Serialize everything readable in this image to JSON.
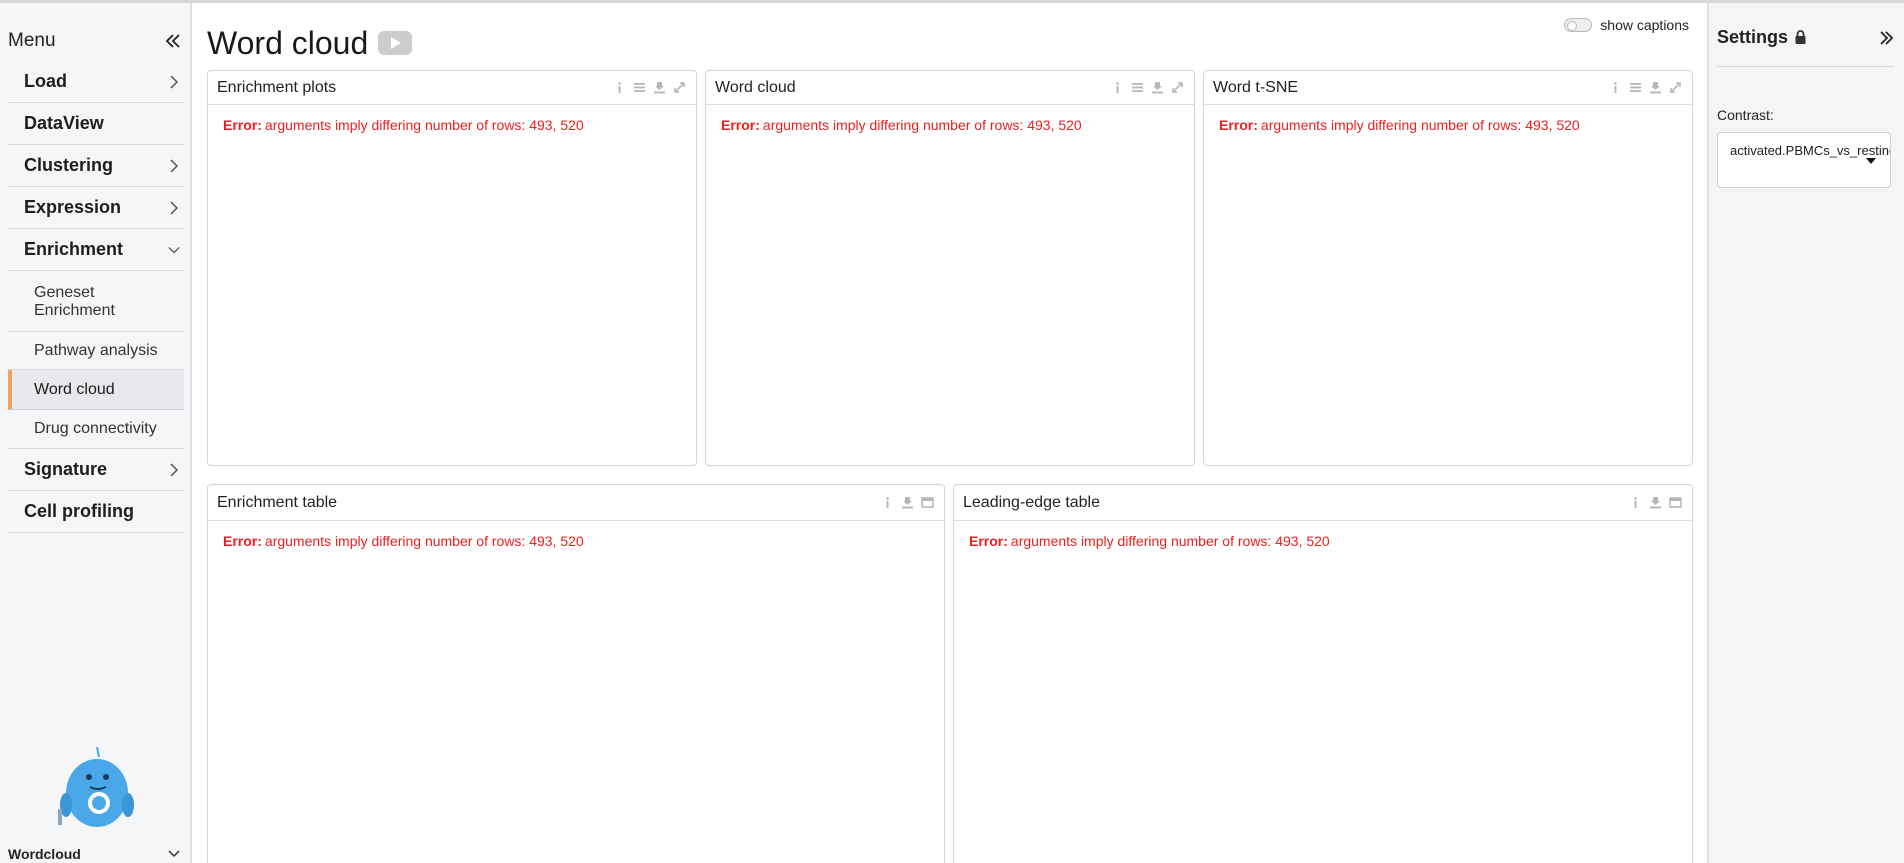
{
  "sidebar": {
    "title": "Menu",
    "items": [
      {
        "label": "Load",
        "chevron": "right"
      },
      {
        "label": "DataView",
        "chevron": ""
      },
      {
        "label": "Clustering",
        "chevron": "right"
      },
      {
        "label": "Expression",
        "chevron": "right"
      },
      {
        "label": "Enrichment",
        "chevron": "down"
      }
    ],
    "subitems": [
      {
        "label": "Geneset\nEnrichment"
      },
      {
        "label": "Pathway analysis"
      },
      {
        "label": "Word cloud",
        "active": true
      },
      {
        "label": "Drug connectivity"
      }
    ],
    "items_after": [
      {
        "label": "Signature",
        "chevron": "right"
      },
      {
        "label": "Cell profiling",
        "chevron": ""
      }
    ],
    "footer_label": "Wordcloud"
  },
  "main": {
    "title": "Word cloud",
    "show_captions_label": "show captions",
    "error_prefix": "Error:",
    "error_message": "arguments imply differing number of rows: 493, 520",
    "panels": [
      {
        "title": "Enrichment plots"
      },
      {
        "title": "Word cloud"
      },
      {
        "title": "Word t-SNE"
      },
      {
        "title": "Enrichment table"
      },
      {
        "title": "Leading-edge table"
      }
    ]
  },
  "settings": {
    "title": "Settings",
    "contrast_label": "Contrast:",
    "contrast_value": "activated.PBMCs_vs_resting"
  },
  "colors": {
    "accent": "#f0a35e",
    "error": "#e8221f",
    "mascot": "#4aa8e8"
  }
}
